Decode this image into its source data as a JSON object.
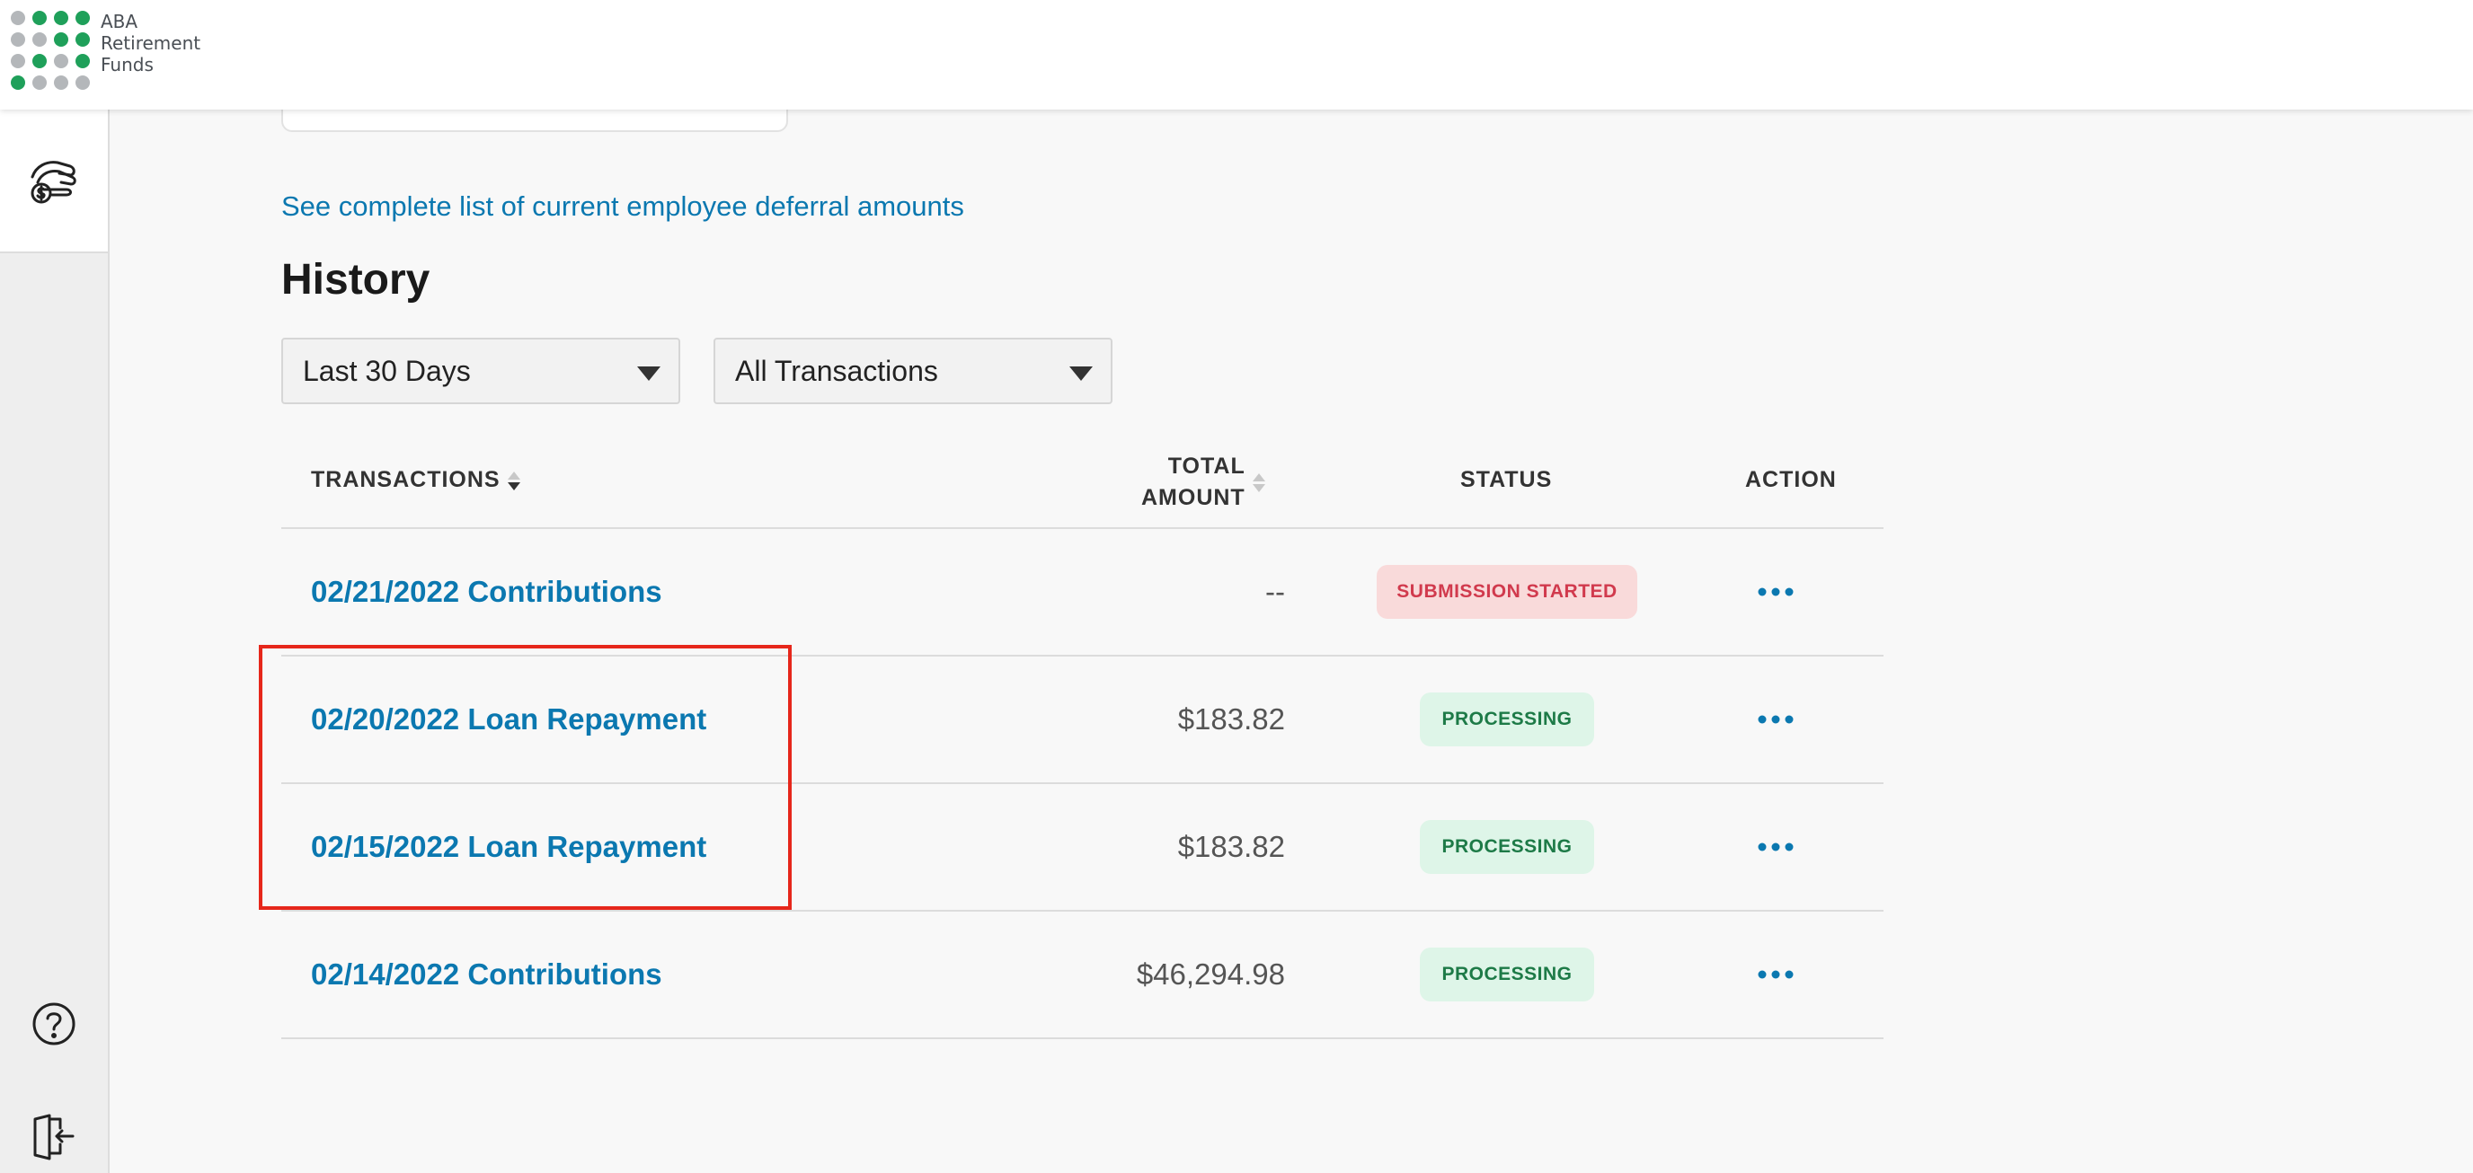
{
  "header": {
    "logo_lines": [
      "ABA",
      "Retirement",
      "Funds"
    ],
    "logo_colors": {
      "green": "#1fa05a",
      "gray": "#b4b7ba"
    }
  },
  "sidebar": {
    "items": [
      {
        "icon": "hand-dollar-icon",
        "active": true
      },
      {
        "icon": "help-icon"
      },
      {
        "icon": "logout-icon"
      }
    ]
  },
  "main": {
    "deferral_link": "See complete list of current employee deferral amounts",
    "history_title": "History",
    "filters": {
      "period": "Last 30 Days",
      "type": "All Transactions"
    },
    "table": {
      "headers": {
        "transactions": "TRANSACTIONS",
        "total_amount_line1": "TOTAL",
        "total_amount_line2": "AMOUNT",
        "status": "STATUS",
        "action": "ACTION"
      },
      "rows": [
        {
          "transaction": "02/21/2022 Contributions",
          "amount": "--",
          "status": "SUBMISSION STARTED",
          "status_type": "submitted"
        },
        {
          "transaction": "02/20/2022 Loan Repayment",
          "amount": "$183.82",
          "status": "PROCESSING",
          "status_type": "processing"
        },
        {
          "transaction": "02/15/2022 Loan Repayment",
          "amount": "$183.82",
          "status": "PROCESSING",
          "status_type": "processing"
        },
        {
          "transaction": "02/14/2022 Contributions",
          "amount": "$46,294.98",
          "status": "PROCESSING",
          "status_type": "processing"
        }
      ]
    }
  },
  "colors": {
    "link": "#0b78b0",
    "highlight": "#e6271b",
    "submitted_bg": "#f9dada",
    "submitted_text": "#d13a4d",
    "processing_bg": "#def5e8",
    "processing_text": "#1d7a47"
  }
}
